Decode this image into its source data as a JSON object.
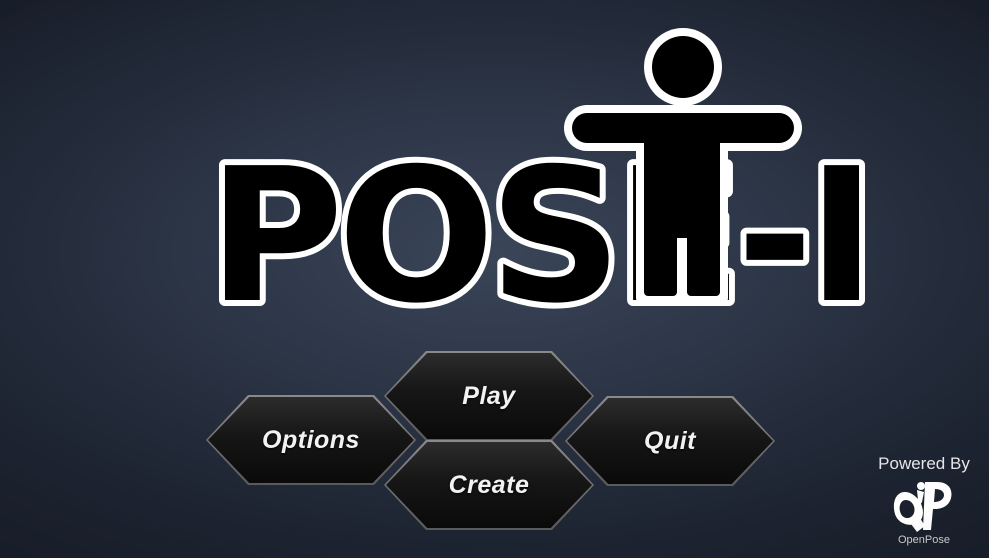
{
  "title": {
    "text": "POSE-I",
    "mascot_icon": "person-arms-out-icon"
  },
  "menu": {
    "play_label": "Play",
    "options_label": "Options",
    "create_label": "Create",
    "quit_label": "Quit"
  },
  "powered_by": {
    "label": "Powered By",
    "logo_text": "OpenPose",
    "logo_icon": "openpose-logo-icon"
  },
  "colors": {
    "background": "#2c3546",
    "logo_fill": "#000000",
    "logo_outline": "#ffffff",
    "button_fill": "#111111",
    "button_border": "#7a7a7a",
    "button_text": "#f2f2f2"
  }
}
